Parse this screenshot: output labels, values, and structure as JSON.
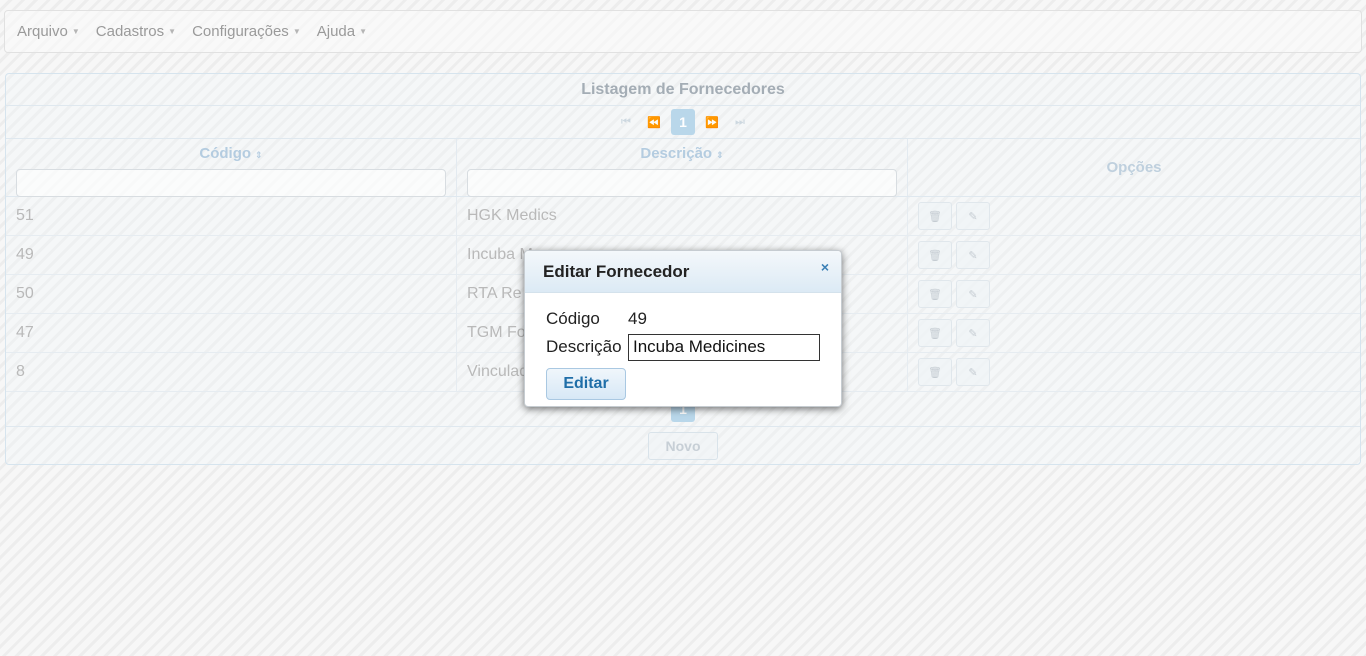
{
  "menu": {
    "items": [
      {
        "label": "Arquivo"
      },
      {
        "label": "Cadastros"
      },
      {
        "label": "Configurações"
      },
      {
        "label": "Ajuda"
      }
    ]
  },
  "table": {
    "title": "Listagem de Fornecedores",
    "current_page": "1",
    "columns": {
      "code": "Código",
      "description": "Descrição",
      "options": "Opções"
    },
    "rows": [
      {
        "code": "51",
        "description": "HGK Medics"
      },
      {
        "code": "49",
        "description": "Incuba M"
      },
      {
        "code": "50",
        "description": "RTA Re"
      },
      {
        "code": "47",
        "description": "TGM Fo"
      },
      {
        "code": "8",
        "description": "Vinculad"
      }
    ],
    "new_button": "Novo"
  },
  "dialog": {
    "title": "Editar Fornecedor",
    "close_icon": "×",
    "code_label": "Código",
    "code_value": "49",
    "description_label": "Descrição",
    "description_value": "Incuba Medicines",
    "submit_label": "Editar"
  },
  "icons": {
    "caret": "▼",
    "sort": "⇕",
    "first": "⏮",
    "prev": "⏪",
    "next": "⏩",
    "last": "⏭",
    "trash": "🗑",
    "pencil": "✎"
  },
  "colors": {
    "accent": "#1f6ea8",
    "header_gradient_end": "#dceaf5"
  }
}
